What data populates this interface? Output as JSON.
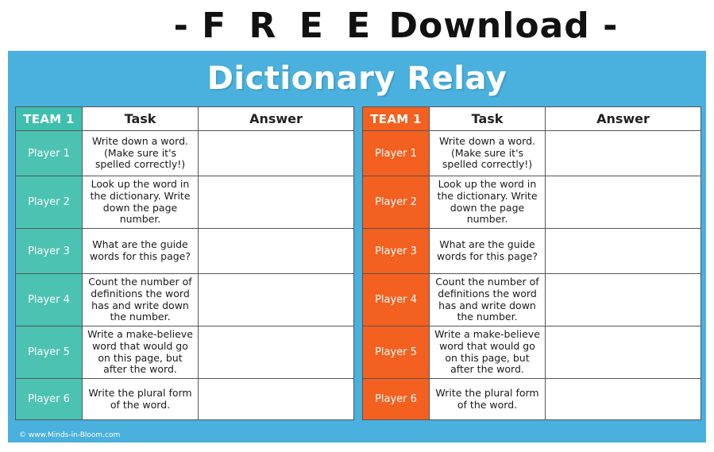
{
  "banner": {
    "free_word": "F R E E",
    "prefix": "- ",
    "suffix": " -",
    "download_word": "Download",
    "full_text": "-  F R E E  Download  -"
  },
  "sheet": {
    "title": "Dictionary Relay",
    "background_color": "#4ab0dd",
    "credit": "© www.Minds-in-Bloom.com"
  },
  "columns": {
    "player": "TEAM 1",
    "task": "Task",
    "answer": "Answer"
  },
  "tables": [
    {
      "id": "team-a",
      "header_color": "#3fbfae",
      "player_color": "#4cc3b2",
      "team_label": "TEAM 1",
      "task_header": "Task",
      "answer_header": "Answer",
      "rows": [
        {
          "player": "Player 1",
          "task": "Write down a word. (Make sure it's spelled correctly!)",
          "answer": ""
        },
        {
          "player": "Player 2",
          "task": "Look up the word in the dictionary. Write down the page number.",
          "answer": ""
        },
        {
          "player": "Player 3",
          "task": "What are the guide words for this page?",
          "answer": ""
        },
        {
          "player": "Player 4",
          "task": "Count the number of definitions the word has and write down the number.",
          "answer": ""
        },
        {
          "player": "Player 5",
          "task": "Write a make-believe word that would go on this page, but after the word.",
          "answer": ""
        },
        {
          "player": "Player 6",
          "task": "Write the plural form of the word.",
          "answer": ""
        }
      ]
    },
    {
      "id": "team-b",
      "header_color": "#f4601f",
      "player_color": "#f4601f",
      "team_label": "TEAM 1",
      "task_header": "Task",
      "answer_header": "Answer",
      "rows": [
        {
          "player": "Player 1",
          "task": "Write down a word. (Make sure it's spelled correctly!)",
          "answer": ""
        },
        {
          "player": "Player 2",
          "task": "Look up the word in the dictionary. Write down the page number.",
          "answer": ""
        },
        {
          "player": "Player 3",
          "task": "What are the guide words for this page?",
          "answer": ""
        },
        {
          "player": "Player 4",
          "task": "Count the number of definitions the word has and write down the number.",
          "answer": ""
        },
        {
          "player": "Player 5",
          "task": "Write a make-believe word that would go on this page, but after the word.",
          "answer": ""
        },
        {
          "player": "Player 6",
          "task": "Write the plural form of the word.",
          "answer": ""
        }
      ]
    }
  ]
}
